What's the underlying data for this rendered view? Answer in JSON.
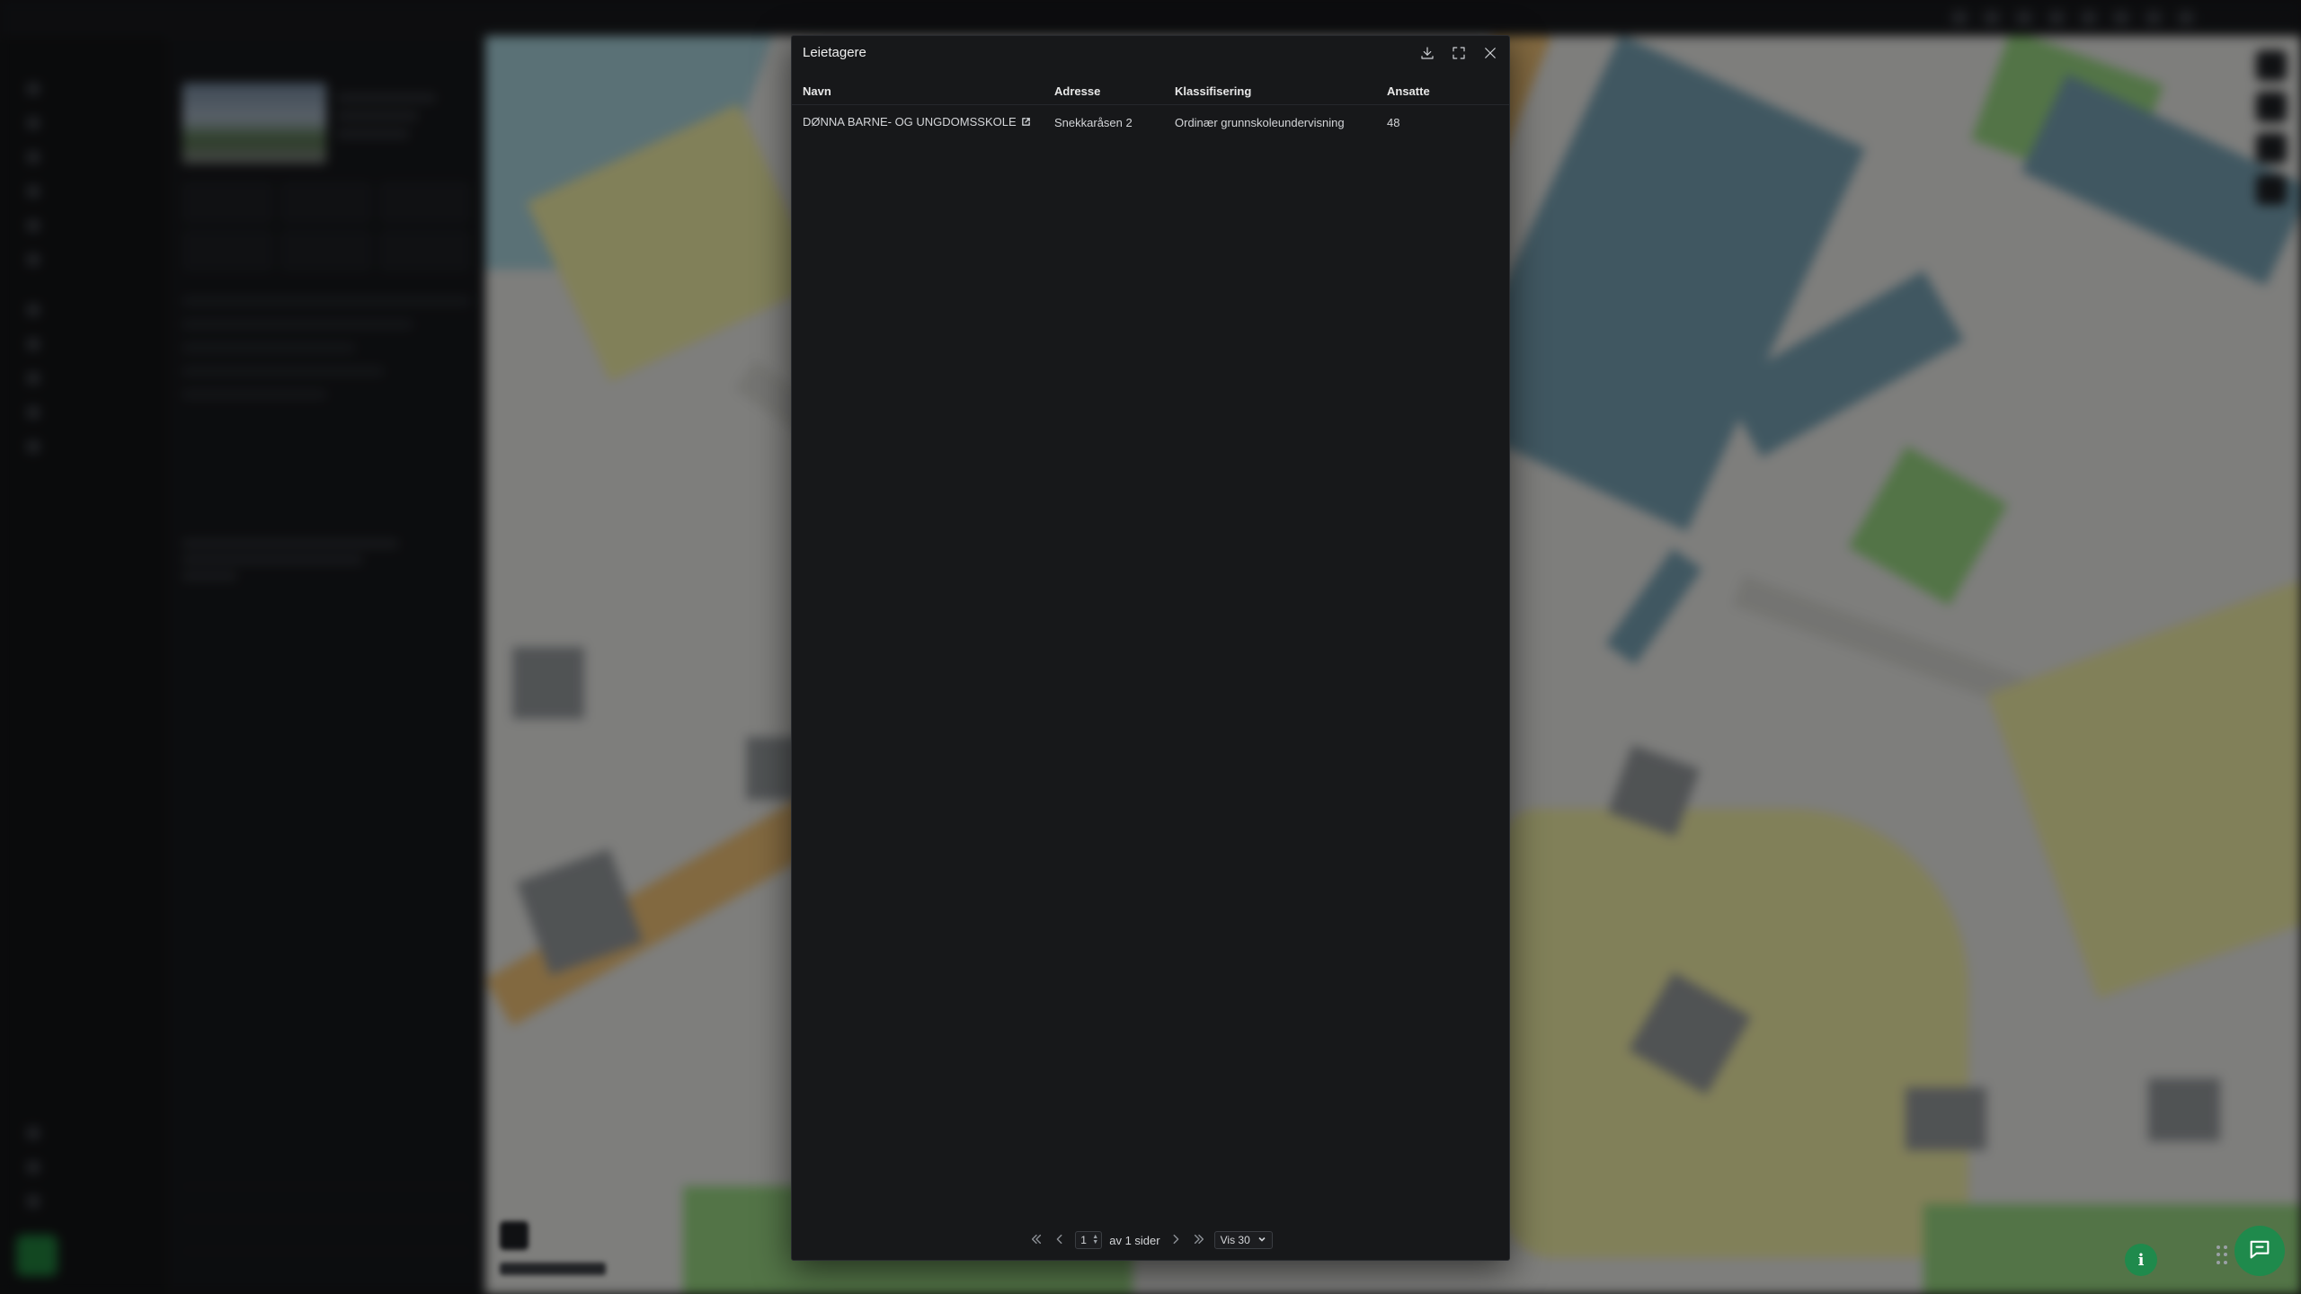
{
  "modal": {
    "title": "Leietagere",
    "actions": {
      "download": "download-icon",
      "fullscreen": "expand-icon",
      "close": "close-icon"
    }
  },
  "table": {
    "columns": [
      "Navn",
      "Adresse",
      "Klassifisering",
      "Ansatte"
    ],
    "rows": [
      {
        "name": "DØNNA BARNE- OG UNGDOMSSKOLE",
        "address": "Snekkaråsen 2",
        "classification": "Ordinær grunnskoleundervisning",
        "employees": "48"
      }
    ]
  },
  "pagination": {
    "current_page": "1",
    "of_pages_text": "av 1 sider",
    "page_size_label": "Vis 30"
  },
  "colors": {
    "modal_bg": "#17181a",
    "accent_green": "#1f8a4c",
    "scrim": "rgba(0,0,0,0.42)"
  }
}
